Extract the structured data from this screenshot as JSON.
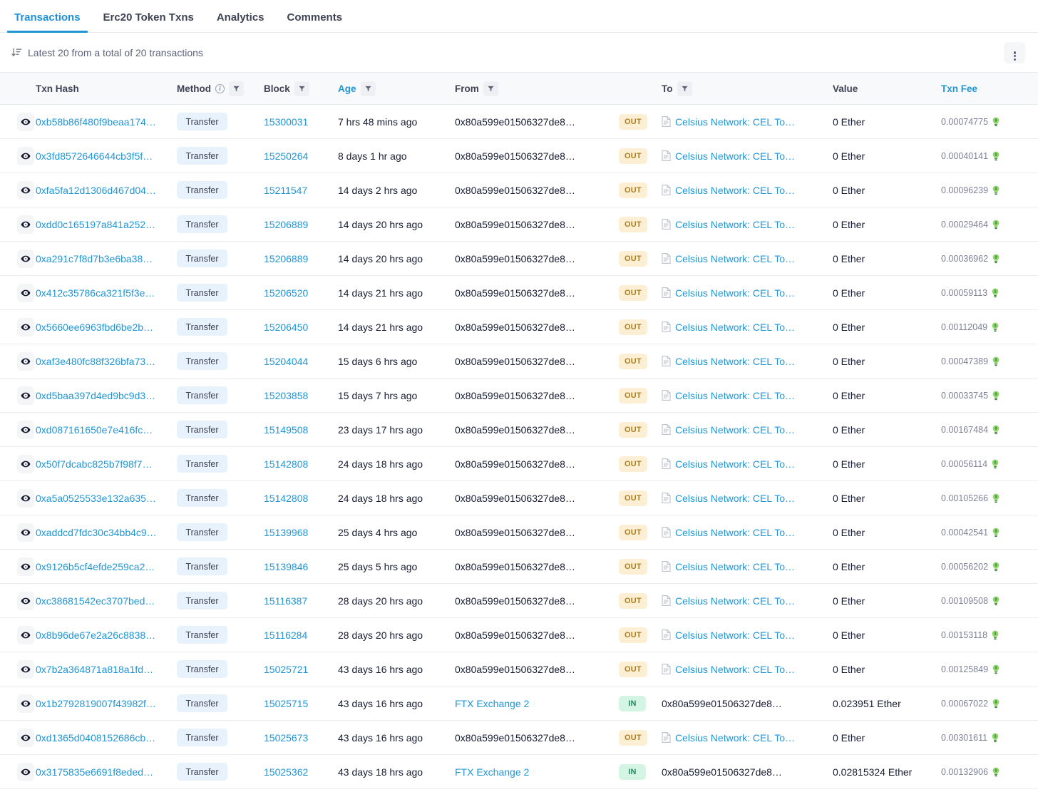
{
  "tabs": [
    {
      "label": "Transactions",
      "active": true
    },
    {
      "label": "Erc20 Token Txns",
      "active": false
    },
    {
      "label": "Analytics",
      "active": false
    },
    {
      "label": "Comments",
      "active": false
    }
  ],
  "summary": {
    "sort_icon": "sort-descending-icon",
    "text": "Latest 20 from a total of 20 transactions",
    "menu_icon": "kebab-menu-icon"
  },
  "table": {
    "columns": [
      {
        "key": "eye",
        "label": "",
        "filter": false,
        "info": false,
        "link": false
      },
      {
        "key": "hash",
        "label": "Txn Hash",
        "filter": false,
        "info": false,
        "link": false
      },
      {
        "key": "method",
        "label": "Method",
        "filter": true,
        "info": true,
        "link": false
      },
      {
        "key": "block",
        "label": "Block",
        "filter": true,
        "info": false,
        "link": false
      },
      {
        "key": "age",
        "label": "Age",
        "filter": true,
        "info": false,
        "link": true
      },
      {
        "key": "from",
        "label": "From",
        "filter": true,
        "info": false,
        "link": false
      },
      {
        "key": "dir",
        "label": "",
        "filter": false,
        "info": false,
        "link": false
      },
      {
        "key": "to",
        "label": "To",
        "filter": true,
        "info": false,
        "link": false
      },
      {
        "key": "value",
        "label": "Value",
        "filter": false,
        "info": false,
        "link": false
      },
      {
        "key": "fee",
        "label": "Txn Fee",
        "filter": false,
        "info": false,
        "link": true
      }
    ],
    "rows": [
      {
        "hash": "0xb58b86f480f9beaa174…",
        "method": "Transfer",
        "block": "15300031",
        "age": "7 hrs 48 mins ago",
        "from": "0x80a599e01506327de8…",
        "from_is_link": false,
        "dir": "OUT",
        "to": "Celsius Network: CEL To…",
        "to_is_link": true,
        "to_contract": true,
        "value": "0 Ether",
        "fee": "0.00074775"
      },
      {
        "hash": "0x3fd8572646644cb3f5f…",
        "method": "Transfer",
        "block": "15250264",
        "age": "8 days 1 hr ago",
        "from": "0x80a599e01506327de8…",
        "from_is_link": false,
        "dir": "OUT",
        "to": "Celsius Network: CEL To…",
        "to_is_link": true,
        "to_contract": true,
        "value": "0 Ether",
        "fee": "0.00040141"
      },
      {
        "hash": "0xfa5fa12d1306d467d04…",
        "method": "Transfer",
        "block": "15211547",
        "age": "14 days 2 hrs ago",
        "from": "0x80a599e01506327de8…",
        "from_is_link": false,
        "dir": "OUT",
        "to": "Celsius Network: CEL To…",
        "to_is_link": true,
        "to_contract": true,
        "value": "0 Ether",
        "fee": "0.00096239"
      },
      {
        "hash": "0xdd0c165197a841a252…",
        "method": "Transfer",
        "block": "15206889",
        "age": "14 days 20 hrs ago",
        "from": "0x80a599e01506327de8…",
        "from_is_link": false,
        "dir": "OUT",
        "to": "Celsius Network: CEL To…",
        "to_is_link": true,
        "to_contract": true,
        "value": "0 Ether",
        "fee": "0.00029464"
      },
      {
        "hash": "0xa291c7f8d7b3e6ba38…",
        "method": "Transfer",
        "block": "15206889",
        "age": "14 days 20 hrs ago",
        "from": "0x80a599e01506327de8…",
        "from_is_link": false,
        "dir": "OUT",
        "to": "Celsius Network: CEL To…",
        "to_is_link": true,
        "to_contract": true,
        "value": "0 Ether",
        "fee": "0.00036962"
      },
      {
        "hash": "0x412c35786ca321f5f3e…",
        "method": "Transfer",
        "block": "15206520",
        "age": "14 days 21 hrs ago",
        "from": "0x80a599e01506327de8…",
        "from_is_link": false,
        "dir": "OUT",
        "to": "Celsius Network: CEL To…",
        "to_is_link": true,
        "to_contract": true,
        "value": "0 Ether",
        "fee": "0.00059113"
      },
      {
        "hash": "0x5660ee6963fbd6be2b…",
        "method": "Transfer",
        "block": "15206450",
        "age": "14 days 21 hrs ago",
        "from": "0x80a599e01506327de8…",
        "from_is_link": false,
        "dir": "OUT",
        "to": "Celsius Network: CEL To…",
        "to_is_link": true,
        "to_contract": true,
        "value": "0 Ether",
        "fee": "0.00112049"
      },
      {
        "hash": "0xaf3e480fc88f326bfa73…",
        "method": "Transfer",
        "block": "15204044",
        "age": "15 days 6 hrs ago",
        "from": "0x80a599e01506327de8…",
        "from_is_link": false,
        "dir": "OUT",
        "to": "Celsius Network: CEL To…",
        "to_is_link": true,
        "to_contract": true,
        "value": "0 Ether",
        "fee": "0.00047389"
      },
      {
        "hash": "0xd5baa397d4ed9bc9d3…",
        "method": "Transfer",
        "block": "15203858",
        "age": "15 days 7 hrs ago",
        "from": "0x80a599e01506327de8…",
        "from_is_link": false,
        "dir": "OUT",
        "to": "Celsius Network: CEL To…",
        "to_is_link": true,
        "to_contract": true,
        "value": "0 Ether",
        "fee": "0.00033745"
      },
      {
        "hash": "0xd087161650e7e416fc…",
        "method": "Transfer",
        "block": "15149508",
        "age": "23 days 17 hrs ago",
        "from": "0x80a599e01506327de8…",
        "from_is_link": false,
        "dir": "OUT",
        "to": "Celsius Network: CEL To…",
        "to_is_link": true,
        "to_contract": true,
        "value": "0 Ether",
        "fee": "0.00167484"
      },
      {
        "hash": "0x50f7dcabc825b7f98f7…",
        "method": "Transfer",
        "block": "15142808",
        "age": "24 days 18 hrs ago",
        "from": "0x80a599e01506327de8…",
        "from_is_link": false,
        "dir": "OUT",
        "to": "Celsius Network: CEL To…",
        "to_is_link": true,
        "to_contract": true,
        "value": "0 Ether",
        "fee": "0.00056114"
      },
      {
        "hash": "0xa5a0525533e132a635…",
        "method": "Transfer",
        "block": "15142808",
        "age": "24 days 18 hrs ago",
        "from": "0x80a599e01506327de8…",
        "from_is_link": false,
        "dir": "OUT",
        "to": "Celsius Network: CEL To…",
        "to_is_link": true,
        "to_contract": true,
        "value": "0 Ether",
        "fee": "0.00105266"
      },
      {
        "hash": "0xaddcd7fdc30c34bb4c9…",
        "method": "Transfer",
        "block": "15139968",
        "age": "25 days 4 hrs ago",
        "from": "0x80a599e01506327de8…",
        "from_is_link": false,
        "dir": "OUT",
        "to": "Celsius Network: CEL To…",
        "to_is_link": true,
        "to_contract": true,
        "value": "0 Ether",
        "fee": "0.00042541"
      },
      {
        "hash": "0x9126b5cf4efde259ca2…",
        "method": "Transfer",
        "block": "15139846",
        "age": "25 days 5 hrs ago",
        "from": "0x80a599e01506327de8…",
        "from_is_link": false,
        "dir": "OUT",
        "to": "Celsius Network: CEL To…",
        "to_is_link": true,
        "to_contract": true,
        "value": "0 Ether",
        "fee": "0.00056202"
      },
      {
        "hash": "0xc38681542ec3707bed…",
        "method": "Transfer",
        "block": "15116387",
        "age": "28 days 20 hrs ago",
        "from": "0x80a599e01506327de8…",
        "from_is_link": false,
        "dir": "OUT",
        "to": "Celsius Network: CEL To…",
        "to_is_link": true,
        "to_contract": true,
        "value": "0 Ether",
        "fee": "0.00109508"
      },
      {
        "hash": "0x8b96de67e2a26c8838…",
        "method": "Transfer",
        "block": "15116284",
        "age": "28 days 20 hrs ago",
        "from": "0x80a599e01506327de8…",
        "from_is_link": false,
        "dir": "OUT",
        "to": "Celsius Network: CEL To…",
        "to_is_link": true,
        "to_contract": true,
        "value": "0 Ether",
        "fee": "0.00153118"
      },
      {
        "hash": "0x7b2a364871a818a1fd…",
        "method": "Transfer",
        "block": "15025721",
        "age": "43 days 16 hrs ago",
        "from": "0x80a599e01506327de8…",
        "from_is_link": false,
        "dir": "OUT",
        "to": "Celsius Network: CEL To…",
        "to_is_link": true,
        "to_contract": true,
        "value": "0 Ether",
        "fee": "0.00125849"
      },
      {
        "hash": "0x1b2792819007f43982f…",
        "method": "Transfer",
        "block": "15025715",
        "age": "43 days 16 hrs ago",
        "from": "FTX Exchange 2",
        "from_is_link": true,
        "dir": "IN",
        "to": "0x80a599e01506327de8…",
        "to_is_link": false,
        "to_contract": false,
        "value": "0.023951 Ether",
        "fee": "0.00067022"
      },
      {
        "hash": "0xd1365d0408152686cb…",
        "method": "Transfer",
        "block": "15025673",
        "age": "43 days 16 hrs ago",
        "from": "0x80a599e01506327de8…",
        "from_is_link": false,
        "dir": "OUT",
        "to": "Celsius Network: CEL To…",
        "to_is_link": true,
        "to_contract": true,
        "value": "0 Ether",
        "fee": "0.00301611"
      },
      {
        "hash": "0x3175835e6691f8eded…",
        "method": "Transfer",
        "block": "15025362",
        "age": "43 days 18 hrs ago",
        "from": "FTX Exchange 2",
        "from_is_link": true,
        "dir": "IN",
        "to": "0x80a599e01506327de8…",
        "to_is_link": false,
        "to_contract": false,
        "value": "0.02815324 Ether",
        "fee": "0.00132906"
      }
    ]
  },
  "icons": {
    "eye": "eye-icon",
    "filter": "filter-icon",
    "contract": "contract-document-icon",
    "gas": "gas-lightbulb-icon"
  },
  "colors": {
    "link_blue": "#2196d6",
    "out_badge_bg": "#fcefd4",
    "out_badge_fg": "#b07d21",
    "in_badge_bg": "#d4f5e4",
    "in_badge_fg": "#1f8a5a",
    "method_pill_bg": "#e8f2fd",
    "header_bg": "#f8f9fb",
    "gas_green": "#6abf4b"
  }
}
